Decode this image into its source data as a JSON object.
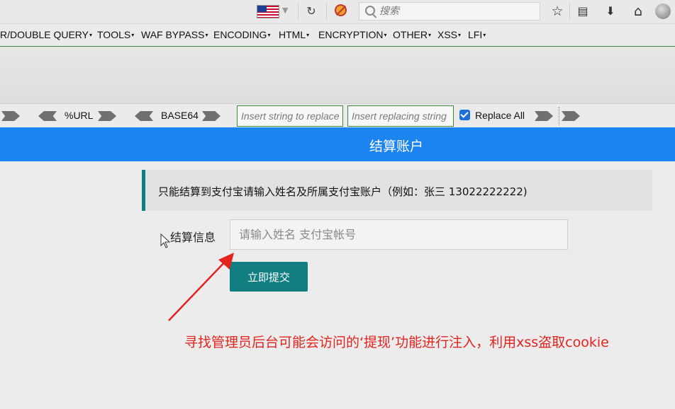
{
  "browser": {
    "search_placeholder": "搜索",
    "icons": [
      "us-flag-icon",
      "reload-icon",
      "noscript-icon",
      "search-icon",
      "bookmark-star-icon",
      "reader-icon",
      "download-icon",
      "home-icon",
      "avatar"
    ]
  },
  "hackbar": {
    "menu": [
      {
        "label": "R/DOUBLE QUERY",
        "caret": "▾"
      },
      {
        "label": "TOOLS",
        "caret": "▾"
      },
      {
        "label": "WAF BYPASS",
        "caret": "▾"
      },
      {
        "label": "ENCODING",
        "caret": "▾"
      },
      {
        "label": "HTML",
        "caret": "▾"
      },
      {
        "label": "ENCRYPTION",
        "caret": "▾"
      },
      {
        "label": "OTHER",
        "caret": "▾"
      },
      {
        "label": "XSS",
        "caret": "▾"
      },
      {
        "label": "LFI",
        "caret": "▾"
      }
    ],
    "url_label": "%URL",
    "base64_label": "BASE64",
    "find_placeholder": "Insert string to replace",
    "replace_placeholder": "Insert replacing string",
    "replace_all_label": "Replace All",
    "replace_all_checked": true,
    "accent_color": "#3c8a3c"
  },
  "page": {
    "header_title": "结算账户",
    "header_color": "#1c84f0",
    "notice": "只能结算到支付宝请输入姓名及所属支付宝账户（例如：张三 13022222222)",
    "field_label": "结算信息",
    "field_placeholder": "请输入姓名 支付宝帐号",
    "submit_label": "立即提交",
    "button_color": "#117e82"
  },
  "annotation": {
    "text": "寻找管理员后台可能会访问的‘提现’功能进行注入，利用xss盗取cookie",
    "color": "#e3231e"
  }
}
